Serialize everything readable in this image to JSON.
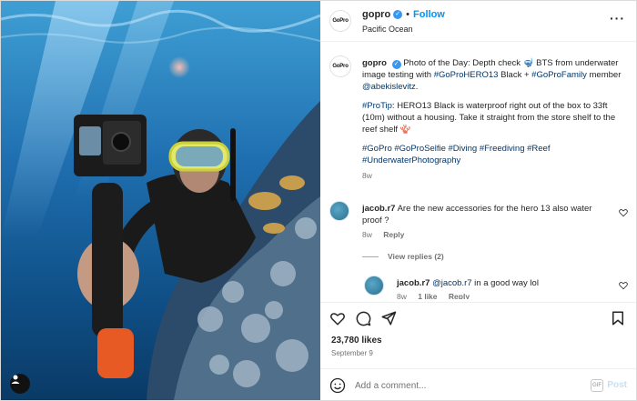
{
  "header": {
    "username": "gopro",
    "follow_label": "Follow",
    "location": "Pacific Ocean",
    "separator": "•",
    "avatar_logo": "GoPro",
    "more_icon": "more-horizontal-icon"
  },
  "caption": {
    "username": "gopro",
    "text_1": "Photo of the Day: Depth check 🤿 BTS from underwater image testing with",
    "tag_1": "#GoProHERO13",
    "text_2": "Black +",
    "tag_2": "#GoProFamily",
    "text_3": "member",
    "mention": "@abekislevitz",
    "text_4": ".",
    "tag_protip": "#ProTip",
    "protip_text": ": HERO13 Black is waterproof right out of the box to 33ft (10m) without a housing. Take it straight from the store shelf to the reef shelf 🪸",
    "hashtags_1": "#GoPro #GoProSelfie #Diving #Freediving #Reef",
    "hashtags_2": "#UnderwaterPhotography",
    "age": "8w"
  },
  "comments": [
    {
      "username": "jacob.r7",
      "text": "Are the new accessories for the hero 13 also water proof ?",
      "age": "8w",
      "reply_label": "Reply",
      "view_replies": "View replies (2)"
    },
    {
      "username": "jacob.r7",
      "mention": "@jacob.r7",
      "text": "in a good way lol",
      "age": "8w",
      "likes": "1 like",
      "reply_label": "Reply"
    }
  ],
  "actions": {
    "likes": "23,780 likes",
    "date": "September 9",
    "icons": [
      "heart-icon",
      "comment-icon",
      "share-icon",
      "bookmark-icon"
    ]
  },
  "add_comment": {
    "placeholder": "Add a comment...",
    "gif_label": "GIF",
    "post_label": "Post"
  },
  "colors": {
    "link": "#00376b",
    "follow": "#0095f6",
    "muted": "#737373",
    "verified": "#3897f0"
  }
}
